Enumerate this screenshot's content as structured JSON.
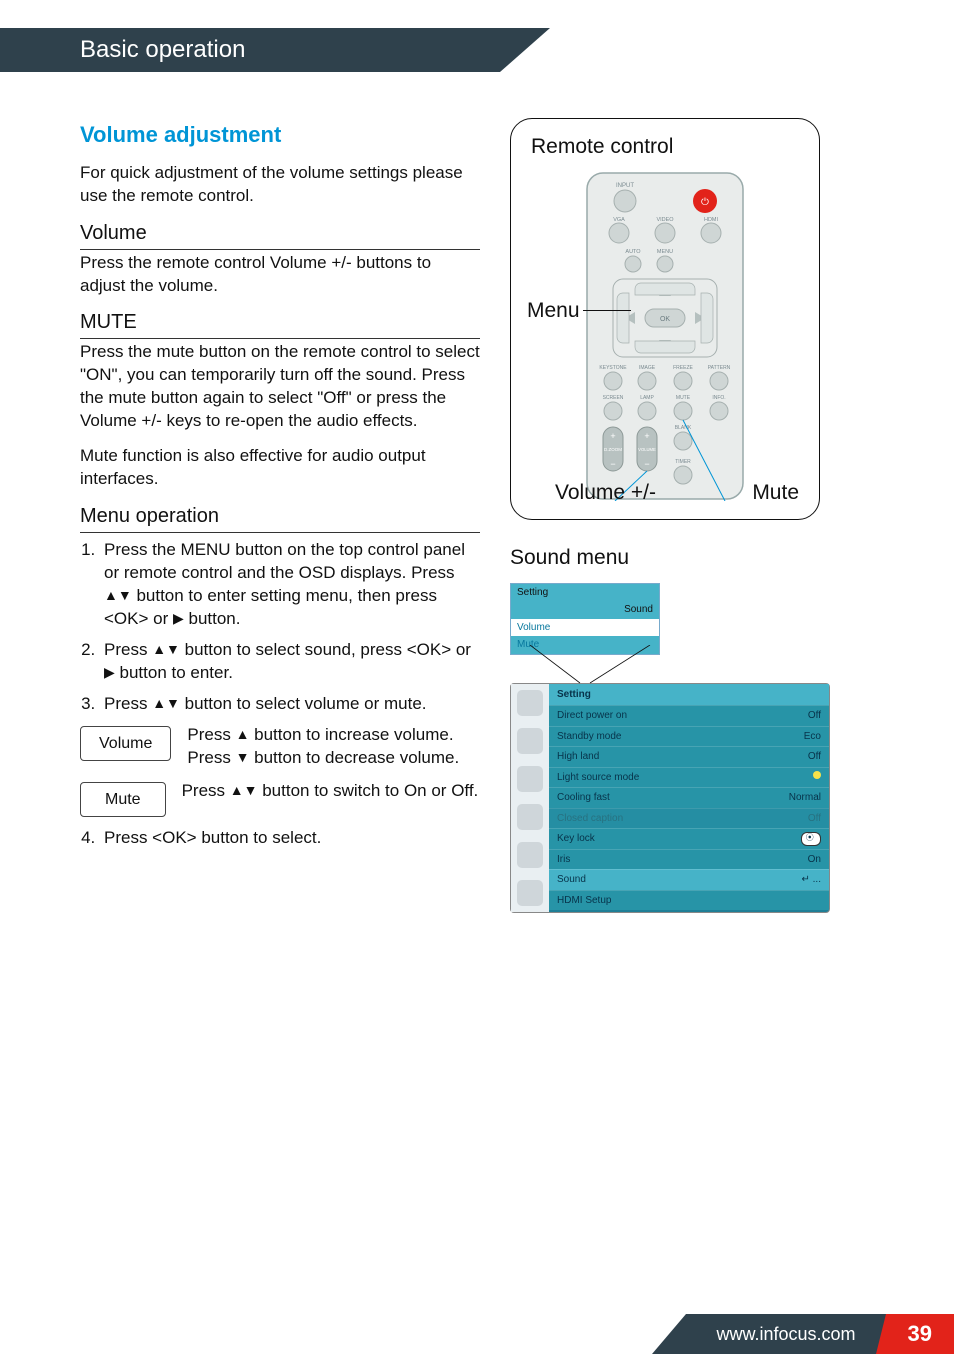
{
  "header": {
    "title": "Basic operation"
  },
  "left": {
    "section_title": "Volume adjustment",
    "intro": "For quick adjustment of the volume settings please use the remote control.",
    "volume_h": "Volume",
    "volume_p": "Press the remote control Volume +/- buttons to adjust the volume.",
    "mute_h": "MUTE",
    "mute_p1": "Press the mute button on the remote control to select \"ON\", you can temporarily turn off the sound. Press the mute button again to select \"Off\" or press the Volume +/- keys to re-open the audio effects.",
    "mute_p2": "Mute function is also effective for audio output interfaces.",
    "menu_h": "Menu operation",
    "step1a": "Press the MENU button on the top control panel or remote control and the OSD displays. Press ",
    "step1b": " button to enter setting menu, then press <OK> or ",
    "step1c": " button.",
    "step2a": "Press ",
    "step2b": " button to select sound, press <OK> or ",
    "step2c": " button to enter.",
    "step3a": "Press ",
    "step3b": " button to select volume or mute.",
    "vol_box": "Volume",
    "vol_desc_a": "Press ",
    "vol_desc_b": " button to increase volume.",
    "vol_desc_c": "Press ",
    "vol_desc_d": " button to decrease volume.",
    "mute_box": "Mute",
    "mute_desc_a": "Press ",
    "mute_desc_b": " button to switch to On or Off.",
    "step4": "Press <OK> button to select."
  },
  "right": {
    "remote_title": "Remote control",
    "menu_label": "Menu",
    "vol_label": "Volume +/-",
    "mute_label": "Mute",
    "sound_title": "Sound menu",
    "popup": {
      "header": "Setting",
      "sound": "Sound",
      "volume": "Volume",
      "mute": "Mute"
    },
    "osd": {
      "header": "Setting",
      "rows": [
        {
          "name": "Direct power on",
          "val": "Off"
        },
        {
          "name": "Standby mode",
          "val": "Eco"
        },
        {
          "name": "High land",
          "val": "Off"
        },
        {
          "name": "Light source mode",
          "val": ""
        },
        {
          "name": "Cooling fast",
          "val": "Normal"
        },
        {
          "name": "Closed caption",
          "val": "Off"
        },
        {
          "name": "Key lock",
          "val": ""
        },
        {
          "name": "Iris",
          "val": "On"
        },
        {
          "name": "Sound",
          "val": "↵   ..."
        },
        {
          "name": "HDMI Setup",
          "val": ""
        }
      ]
    },
    "remote_labels": {
      "input": "INPUT",
      "vga": "VGA",
      "video": "VIDEO",
      "hdmi": "HDMI",
      "auto": "AUTO",
      "menu": "MENU",
      "ok": "OK",
      "keystone": "KEYSTONE",
      "image": "IMAGE",
      "freeze": "FREEZE",
      "pattern": "PATTERN",
      "screen": "SCREEN",
      "lamp": "LAMP",
      "mute": "MUTE",
      "info": "INFO.",
      "blank": "BLANK",
      "dzoom": "D.ZOOM",
      "volume": "VOLUME",
      "timer": "TIMER"
    }
  },
  "footer": {
    "url": "www.infocus.com",
    "page": "39"
  }
}
